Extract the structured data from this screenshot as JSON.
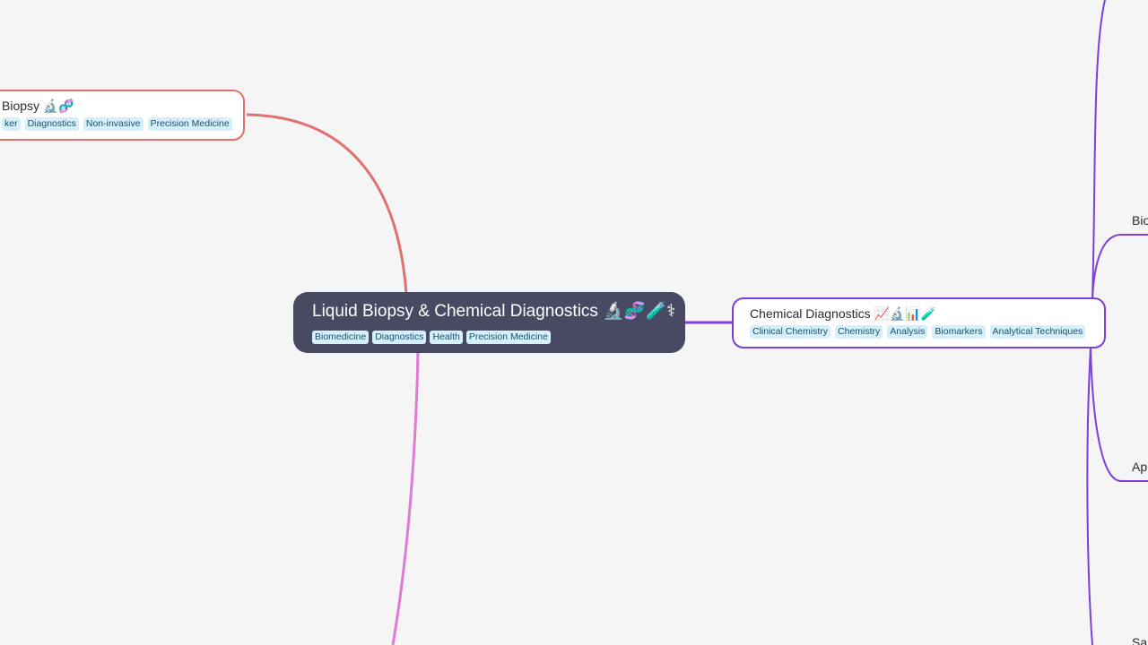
{
  "colors": {
    "background": "#f5f5f5",
    "root_fill": "#474a62",
    "branch_left": "#e0716d",
    "branch_right": "#7c3fdc",
    "branch_bottom": "#e07ad6",
    "tag_fill": "#d4f0fb"
  },
  "root": {
    "title": "Liquid Biopsy & Chemical Diagnostics 🔬🧬🧪⚕",
    "tags": [
      "Biomedicine",
      "Diagnostics",
      "Health",
      "Precision Medicine"
    ]
  },
  "left_node": {
    "title": "Biopsy 🔬🧬",
    "tags": [
      "ker",
      "Diagnostics",
      "Non-invasive",
      "Precision Medicine"
    ]
  },
  "right_node": {
    "title": "Chemical Diagnostics 📈🔬📊🧪",
    "tags": [
      "Clinical Chemistry",
      "Chemistry",
      "Analysis",
      "Biomarkers",
      "Analytical Techniques"
    ]
  },
  "offscreen_labels": [
    "Bio",
    "App",
    "Sa"
  ]
}
